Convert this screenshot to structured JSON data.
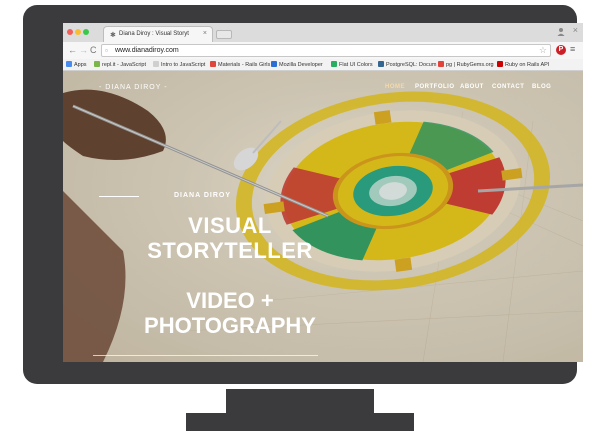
{
  "browser": {
    "tab_title": "Diana Diroy : Visual Storyt",
    "tab_close": "×",
    "url": "www.dianadiroy.com",
    "back": "←",
    "forward": "→",
    "reload": "C",
    "star": "☆",
    "menu": "≡",
    "window_close": "×",
    "pinterest": "P"
  },
  "bookmarks": [
    {
      "label": "Apps",
      "color": "#4a8bf0"
    },
    {
      "label": "repl.it - JavaScript",
      "color": "#7ab648"
    },
    {
      "label": "Intro to JavaScript",
      "color": "#cfcfcf"
    },
    {
      "label": "Materials - Rails Girls",
      "color": "#e0453b"
    },
    {
      "label": "Mozilla Developer",
      "color": "#2a6fd6"
    },
    {
      "label": "Flat UI Colors",
      "color": "#27ae60"
    },
    {
      "label": "PostgreSQL: Docum",
      "color": "#336791"
    },
    {
      "label": "pg | RubyGems.org",
      "color": "#e2443b"
    },
    {
      "label": "Ruby on Rails API",
      "color": "#cc0000"
    }
  ],
  "site": {
    "brand": "- DIANA DIROY -",
    "nav": [
      "HOME",
      "PORTFOLIO",
      "ABOUT",
      "CONTACT",
      "BLOG"
    ],
    "hero": {
      "name": "DIANA DIROY",
      "line1": "VISUAL",
      "line2": "STORYTELLER",
      "line3": "VIDEO +",
      "line4": "PHOTOGRAPHY"
    }
  },
  "colors": {
    "monitor": "#3b3b3d",
    "mandala_yellow": "#f2d21e",
    "mandala_red": "#d9453a",
    "mandala_green": "#3aa86a"
  }
}
